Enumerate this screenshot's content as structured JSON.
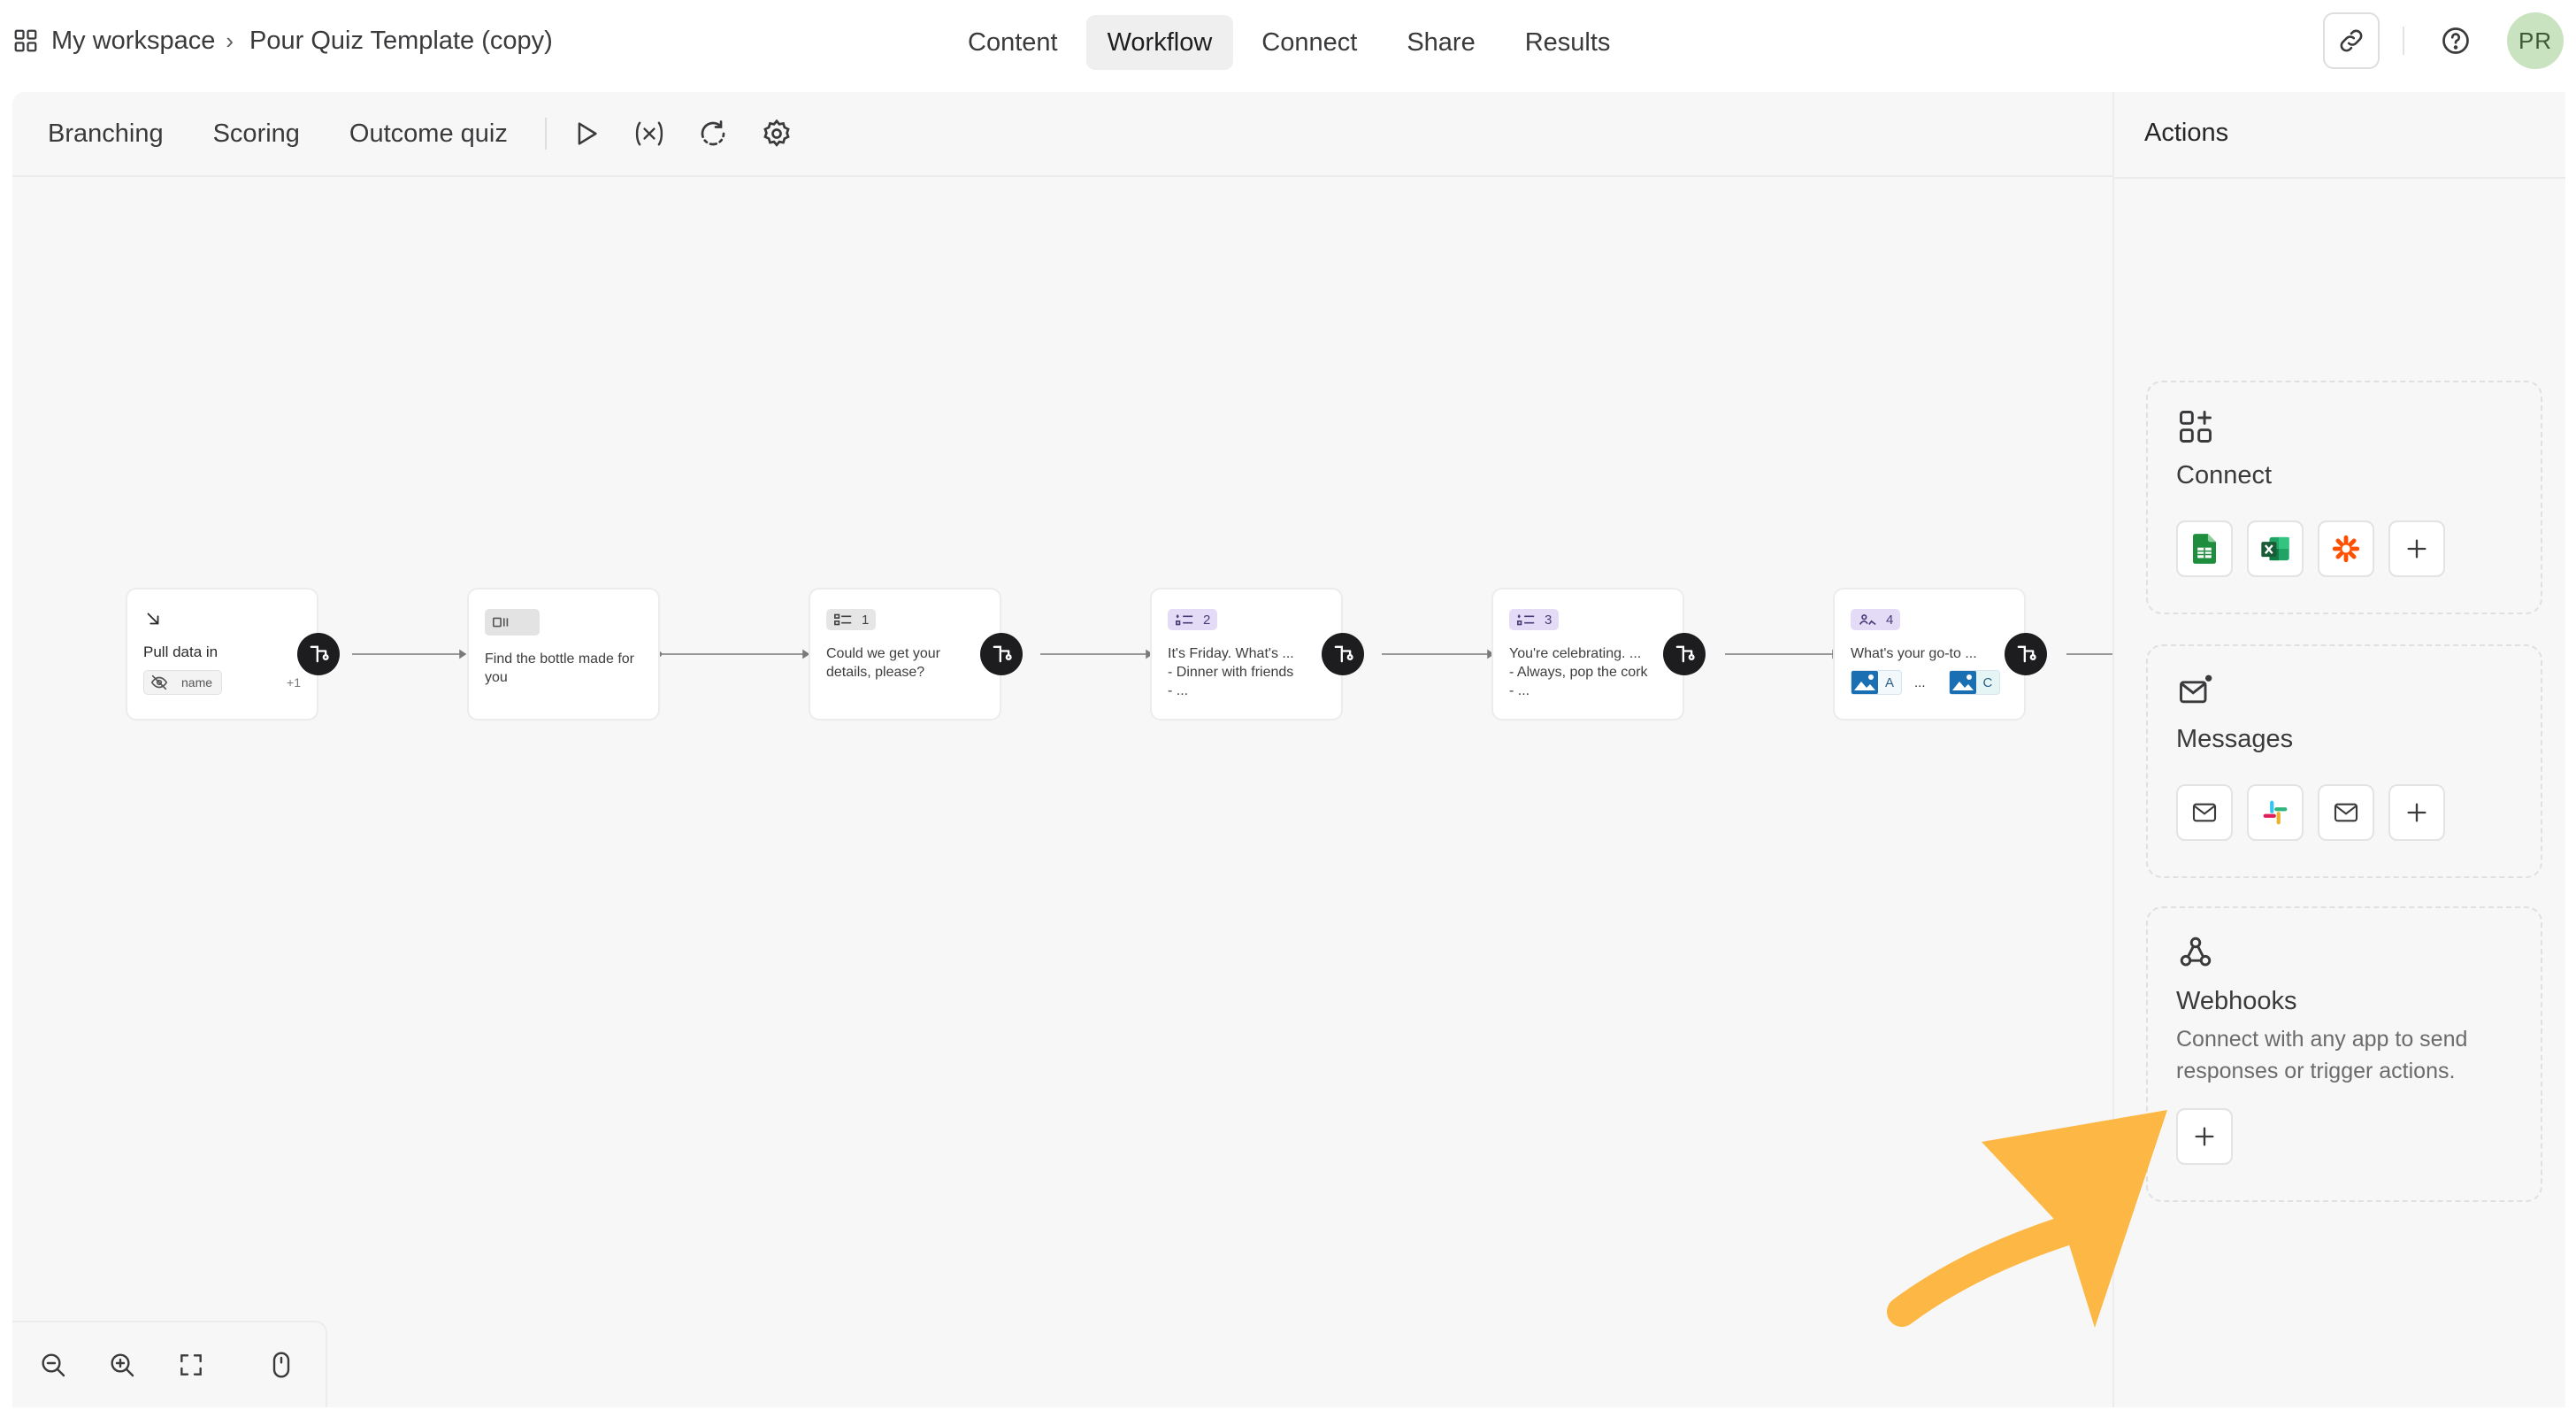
{
  "breadcrumb": {
    "workspace": "My workspace",
    "form": "Pour Quiz Template (copy)"
  },
  "tabs": [
    {
      "label": "Content"
    },
    {
      "label": "Workflow",
      "active": true
    },
    {
      "label": "Connect"
    },
    {
      "label": "Share"
    },
    {
      "label": "Results"
    }
  ],
  "user": {
    "initials": "PR"
  },
  "toolbar": {
    "branching": "Branching",
    "scoring": "Scoring",
    "outcome": "Outcome quiz"
  },
  "nodes": [
    {
      "title": "Pull data in",
      "tag": "name",
      "more": "+1"
    },
    {
      "text": "Find the bottle made for you"
    },
    {
      "num": "1",
      "text": "Could we get your details, please?"
    },
    {
      "num": "2",
      "line1": "It's Friday. What's ...",
      "line2": "- Dinner with friends",
      "line3": "- ..."
    },
    {
      "num": "3",
      "line1": "You're celebrating. ...",
      "line2": "- Always, pop the cork",
      "line3": "- ..."
    },
    {
      "num": "4",
      "line1": "What's your go-to ...",
      "choice_a": "A",
      "ellipsis": "...",
      "choice_c": "C"
    }
  ],
  "actions": {
    "title": "Actions",
    "connect": {
      "title": "Connect"
    },
    "messages": {
      "title": "Messages"
    },
    "webhooks": {
      "title": "Webhooks",
      "description": "Connect with any app to send responses or trigger actions."
    }
  },
  "colors": {
    "accent_arrow": "#FDB744",
    "sheets": "#1E8E3E",
    "excel": "#1D6F42",
    "zapier": "#FF4F00"
  }
}
